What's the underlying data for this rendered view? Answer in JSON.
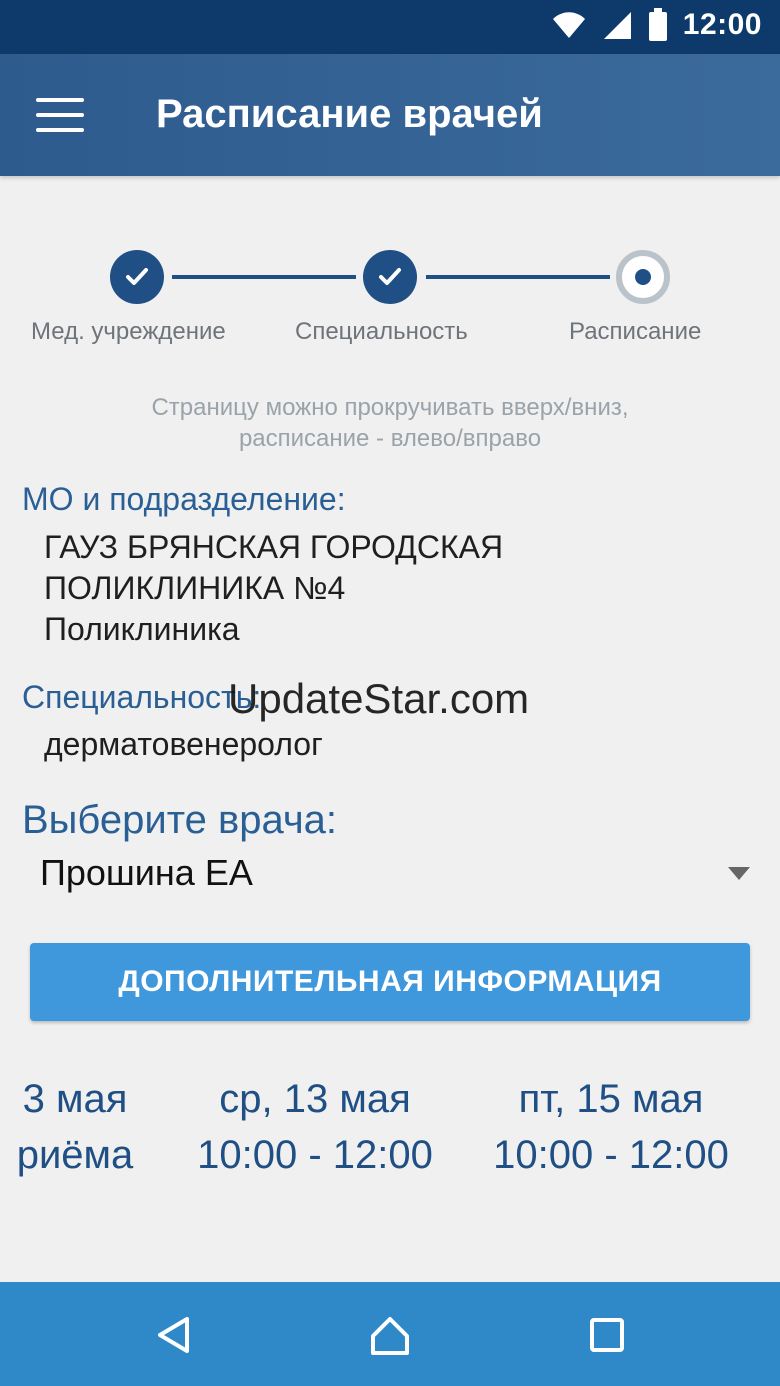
{
  "status_bar": {
    "time": "12:00",
    "icons": [
      "wifi-icon",
      "signal-icon",
      "battery-icon"
    ]
  },
  "app_bar": {
    "title": "Расписание врачей"
  },
  "stepper": {
    "steps": [
      {
        "label": "Мед. учреждение",
        "state": "done"
      },
      {
        "label": "Специальность",
        "state": "done"
      },
      {
        "label": "Расписание",
        "state": "current"
      }
    ]
  },
  "hint": {
    "line1": "Страницу можно прокручивать вверх/вниз,",
    "line2": "расписание - влево/вправо"
  },
  "organization": {
    "label": "МО и подразделение:",
    "line1": "ГАУЗ БРЯНСКАЯ ГОРОДСКАЯ",
    "line2": "ПОЛИКЛИНИКА №4",
    "line3": "Поликлиника"
  },
  "specialty": {
    "label": "Специальность:",
    "value": "дерматовенеролог"
  },
  "watermark": "UpdateStar.com",
  "doctor": {
    "label": "Выберите врача:",
    "selected": "Прошина ЕА"
  },
  "info_button": {
    "label": "ДОПОЛНИТЕЛЬНАЯ ИНФОРМАЦИЯ"
  },
  "schedule": {
    "days": [
      {
        "date": "3 мая",
        "time": "риёма"
      },
      {
        "date": "ср, 13 мая",
        "time": "10:00 - 12:00"
      },
      {
        "date": "пт, 15 мая",
        "time": "10:00 - 12:00"
      }
    ]
  },
  "navigation": {
    "icons": [
      "back-icon",
      "home-icon",
      "recent-apps-icon"
    ]
  },
  "colors": {
    "status_bar": "#0e3a6b",
    "app_bar": "#2e5b8e",
    "primary_text": "#2a5f95",
    "button": "#3f97dc",
    "nav_bar": "#2f88c8"
  }
}
